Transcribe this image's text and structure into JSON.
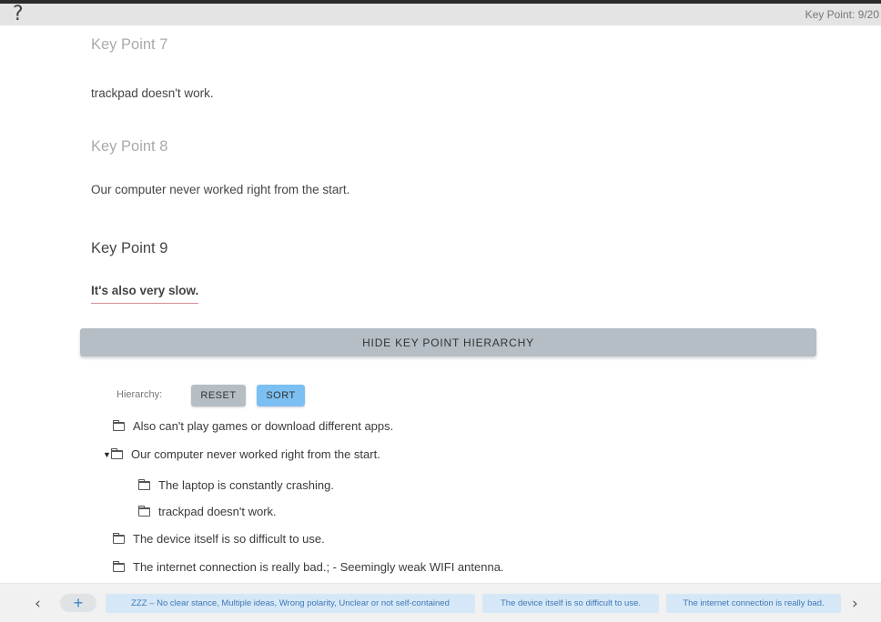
{
  "header": {
    "help_label": "?",
    "progress": "Key Point: 9/20"
  },
  "key_points": [
    {
      "title": "Key Point 7",
      "text": "trackpad doesn't work."
    },
    {
      "title": "Key Point 8",
      "text": "Our computer never worked right from the start."
    },
    {
      "title": "Key Point 9",
      "text": "It's also very slow."
    }
  ],
  "hide_button": "HIDE KEY POINT HIERARCHY",
  "hierarchy": {
    "label": "Hierarchy:",
    "reset_label": "RESET",
    "sort_label": "SORT",
    "items": [
      "Also can't play games or download different apps.",
      "Our computer never worked right from the start.",
      "The laptop is constantly crashing.",
      "trackpad doesn't work.",
      "The device itself is so difficult to use.",
      "The internet connection is really bad.; - Seemingly weak WIFI antenna."
    ]
  },
  "bottom": {
    "prev_label": "‹",
    "add_label": "+",
    "next_label": "›",
    "chips": [
      "ZZZ – No clear stance, Multiple ideas, Wrong polarity, Unclear or not self-contained",
      "The device itself is so difficult to use.",
      "The internet connection is really bad."
    ]
  },
  "colors": {
    "accent_blue": "#7cbff2",
    "chip_bg": "#d6e8f7",
    "button_gray": "#b5bec4",
    "underline": "#d98a95"
  }
}
